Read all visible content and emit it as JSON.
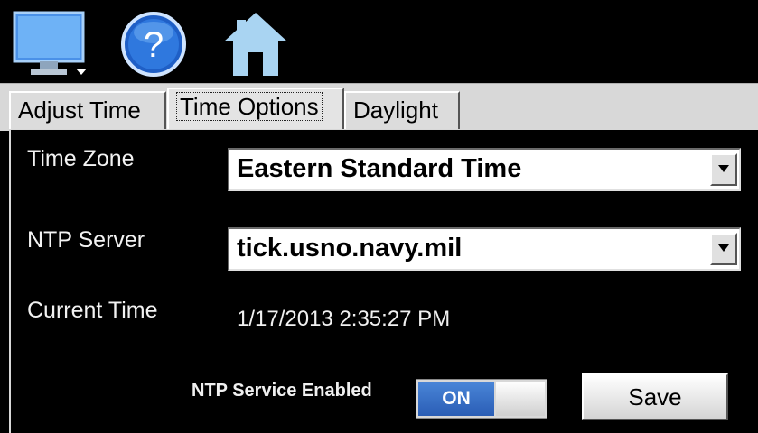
{
  "toolbar": {
    "icons": [
      "monitor-icon",
      "help-icon",
      "home-icon"
    ],
    "help_symbol": "?"
  },
  "tabs": [
    {
      "label": "Adjust Time",
      "selected": false
    },
    {
      "label": "Time Options",
      "selected": true
    },
    {
      "label": "Daylight",
      "selected": false
    }
  ],
  "form": {
    "time_zone_label": "Time Zone",
    "time_zone_value": "Eastern Standard Time",
    "ntp_server_label": "NTP Server",
    "ntp_server_value": "tick.usno.navy.mil",
    "current_time_label": "Current Time",
    "current_time_value": "1/17/2013 2:35:27 PM",
    "ntp_service_label": "NTP Service Enabled",
    "ntp_service_state": "ON",
    "save_label": "Save"
  },
  "colors": {
    "background": "#000000",
    "tab_strip": "#d8d8d8",
    "toggle_on": "#2a5db5",
    "help_blue": "#1f5fc6",
    "home_blue": "#a9d4f2"
  }
}
